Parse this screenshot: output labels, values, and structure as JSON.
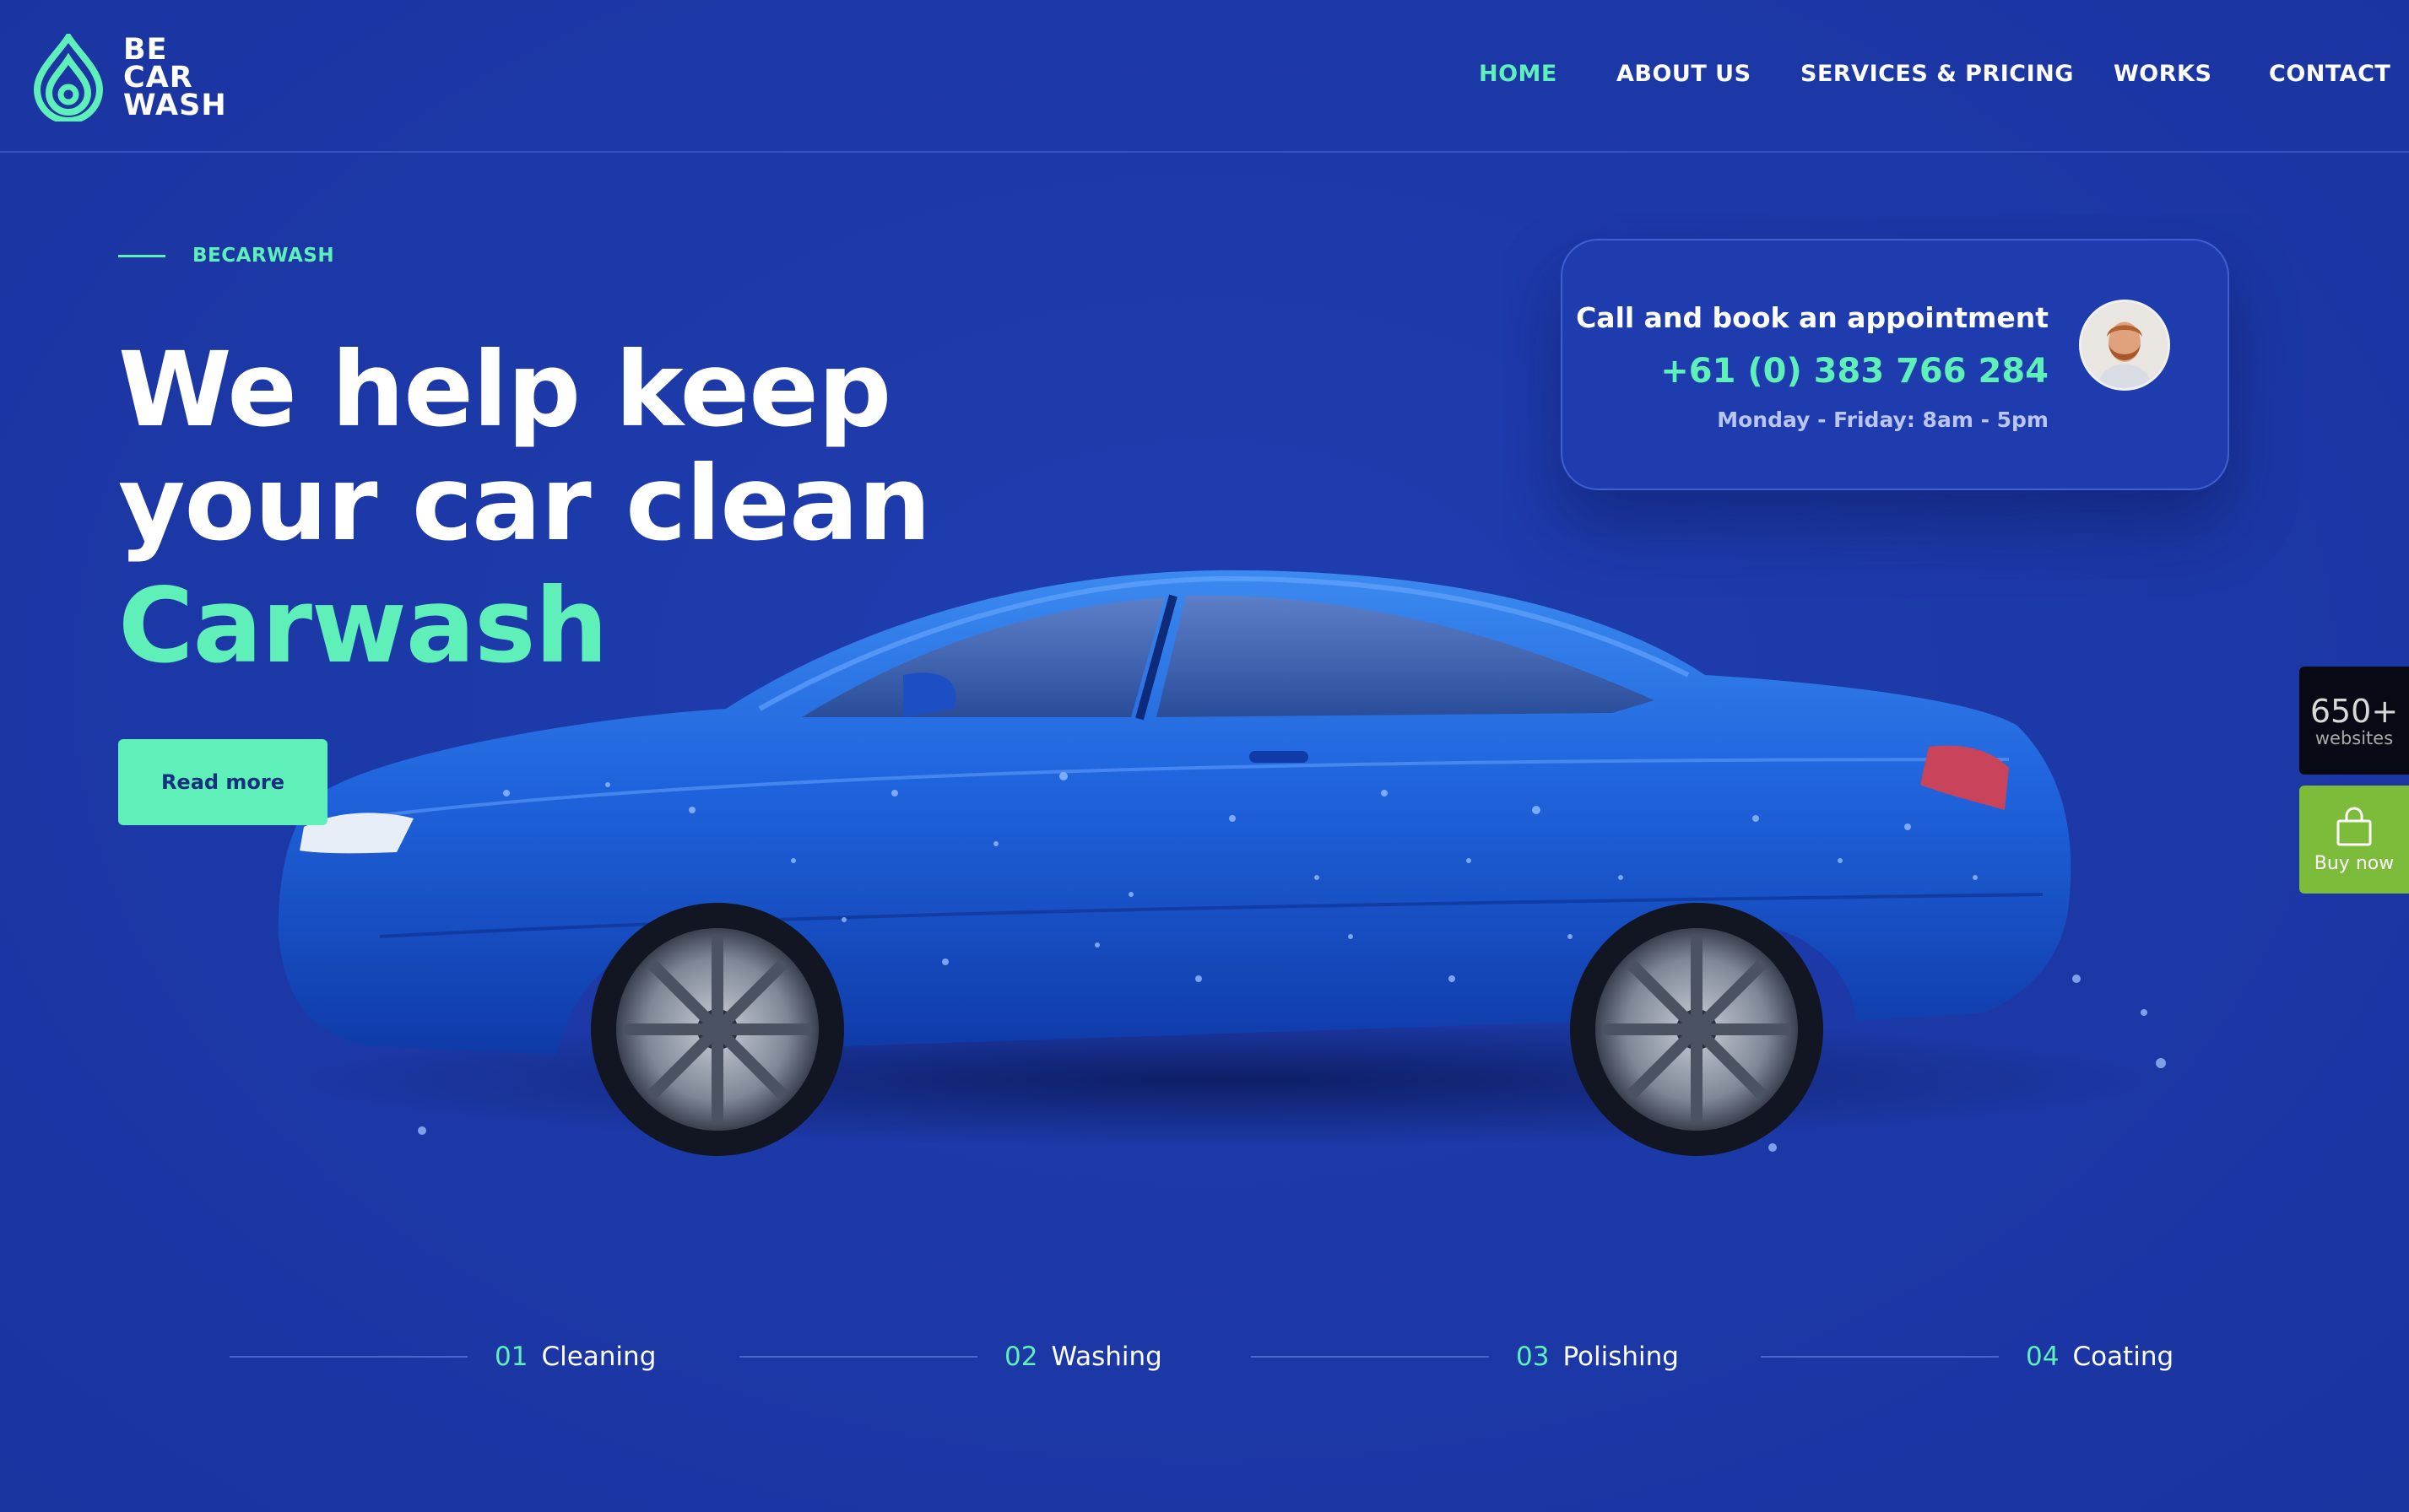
{
  "header": {
    "logo_lines": [
      "BE",
      "CAR",
      "WASH"
    ],
    "nav": [
      {
        "label": "HOME",
        "active": true
      },
      {
        "label": "ABOUT US",
        "active": false
      },
      {
        "label": "SERVICES & PRICING",
        "active": false
      },
      {
        "label": "WORKS",
        "active": false
      },
      {
        "label": "CONTACT",
        "active": false
      }
    ]
  },
  "hero": {
    "eyebrow": "BECARWASH",
    "headline_line1": "We help keep",
    "headline_line2": "your car clean",
    "headline_accent": "Carwash",
    "cta_label": "Read more"
  },
  "appointment": {
    "title": "Call and book an appointment",
    "phone": "+61 (0) 383 766 284",
    "hours": "Monday - Friday: 8am - 5pm"
  },
  "side_widgets": {
    "websites_count": "650+",
    "websites_label": "websites",
    "buy_label": "Buy now"
  },
  "steps": [
    {
      "num": "01",
      "label": "Cleaning"
    },
    {
      "num": "02",
      "label": "Washing"
    },
    {
      "num": "03",
      "label": "Polishing"
    },
    {
      "num": "04",
      "label": "Coating"
    }
  ],
  "colors": {
    "background": "#1d3aa9",
    "accent": "#5ef0b8",
    "car_body": "#1e5fd6",
    "buy_widget": "#7dbb3b"
  },
  "icons": [
    "water-drop-logo-icon",
    "shopping-bag-icon"
  ]
}
